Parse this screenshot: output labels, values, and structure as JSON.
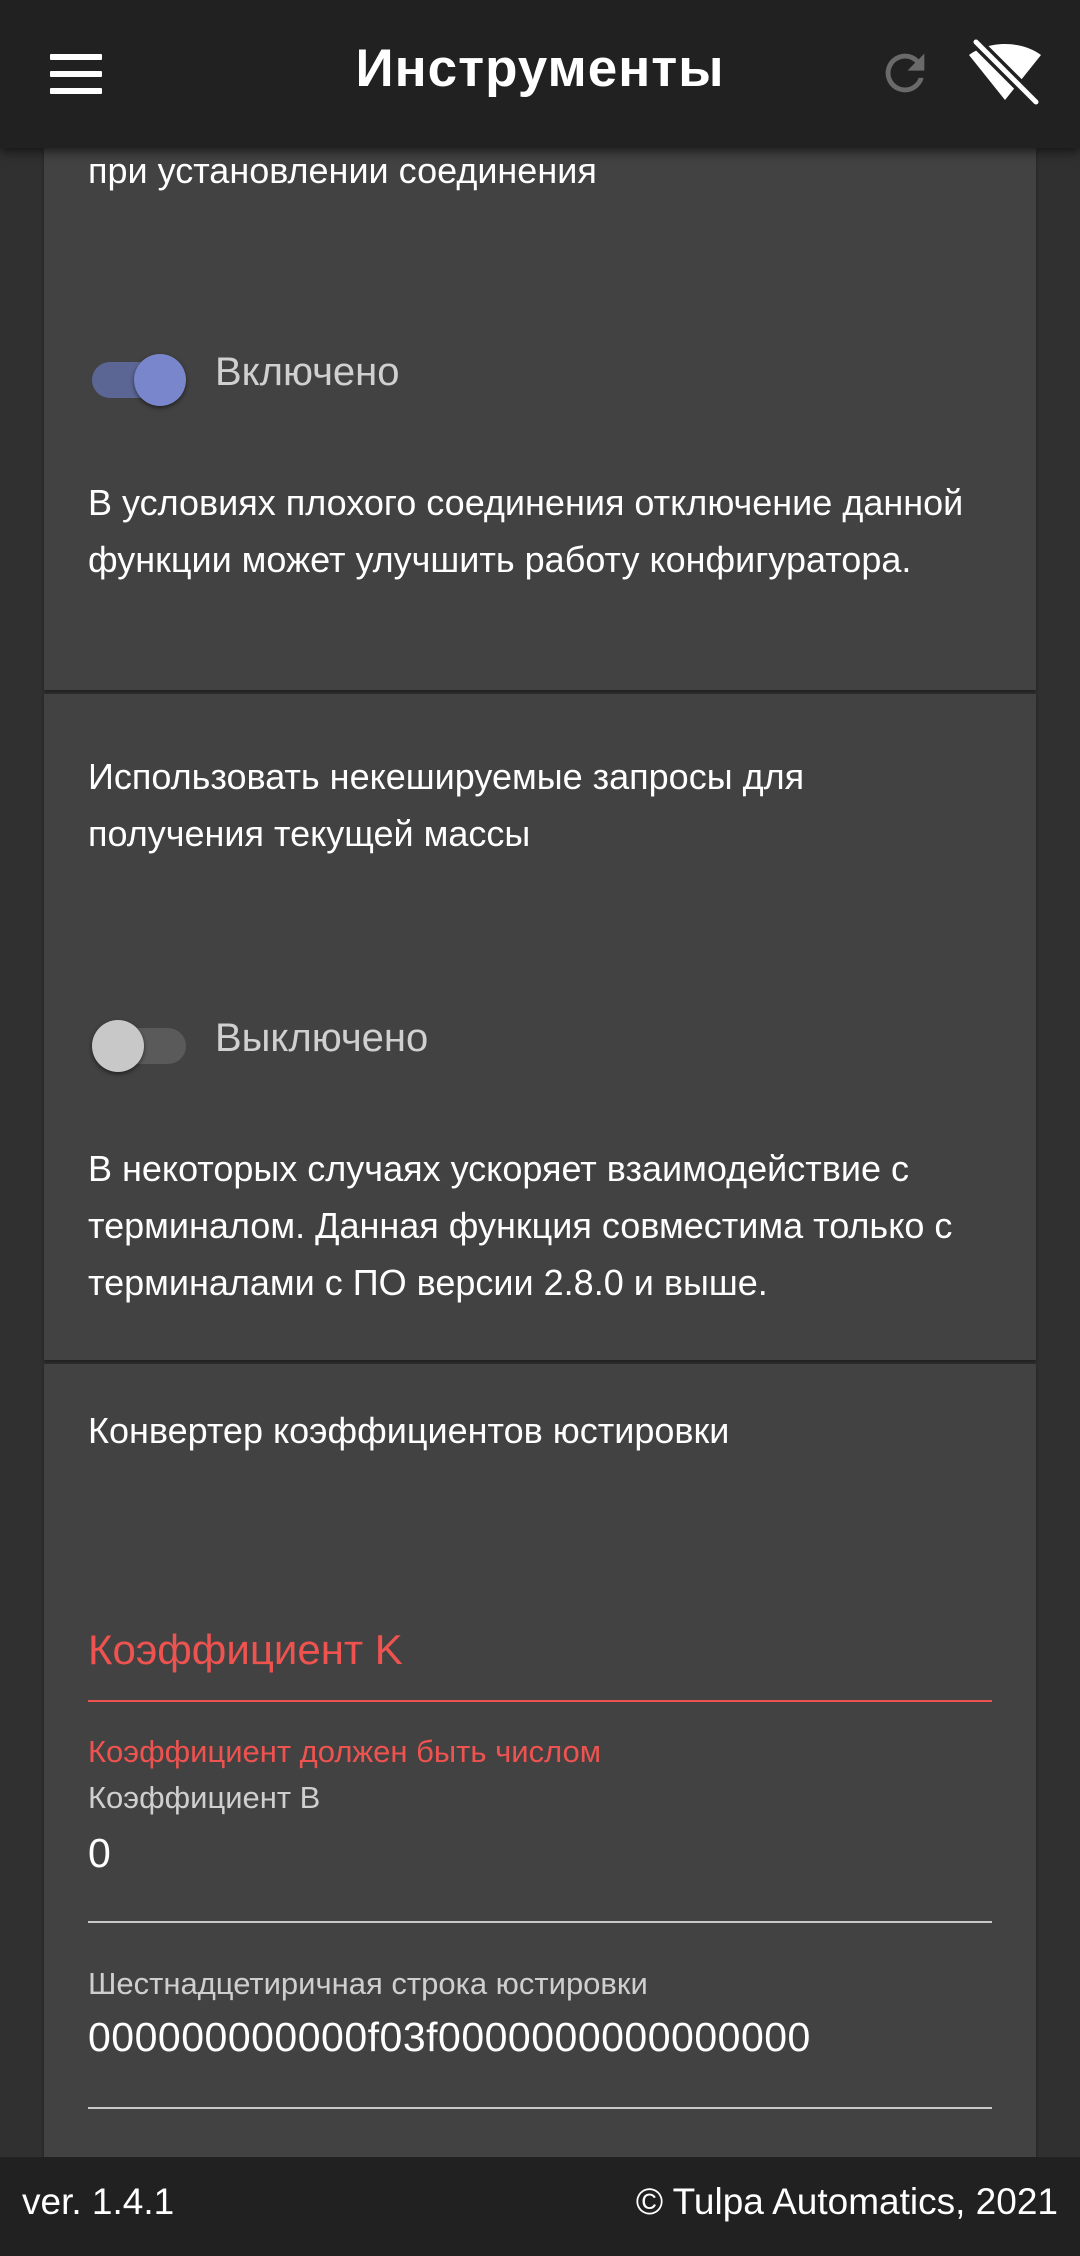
{
  "appbar": {
    "title": "Инструменты",
    "menu_icon": "hamburger-menu-icon",
    "refresh_icon": "refresh-icon",
    "connection_icon": "wifi-off-icon"
  },
  "card1": {
    "title_tail": "при установлении соединения",
    "toggle_state": "Включено",
    "toggle_on": true,
    "description": "В условиях плохого соединения отключение данной функции может улучшить работу конфигуратора."
  },
  "card2": {
    "title": "Использовать некешируемые запросы для получения текущей массы",
    "toggle_state": "Выключено",
    "toggle_on": false,
    "description": "В некоторых случаях ускоряет взаимодействие с терминалом. Данная функция совместима только с терминалами с ПО версии 2.8.0 и выше."
  },
  "card3": {
    "title": "Конвертер коэффициентов юстировки",
    "coef_k": {
      "placeholder": "Коэффициент K",
      "value": "",
      "error": "Коэффициент должен быть числом"
    },
    "coef_b": {
      "label": "Коэффициент B",
      "value": "0"
    },
    "hex_string": {
      "label": "Шестнадцетиричная строка юстировки",
      "value": "000000000000f03f0000000000000000"
    }
  },
  "footer": {
    "version": "ver. 1.4.1",
    "copyright": "© Tulpa Automatics, 2021"
  },
  "colors": {
    "accent": "#7986cb",
    "error": "#ef5350",
    "card": "#424242",
    "background": "#303030",
    "appbar": "#212121"
  }
}
